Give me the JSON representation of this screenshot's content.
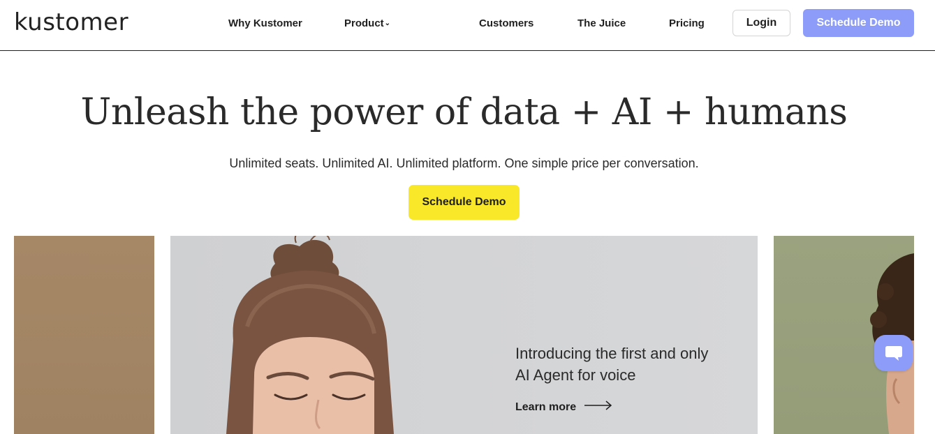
{
  "header": {
    "logo": "kustomer",
    "nav": {
      "why": "Why Kustomer",
      "product": "Product",
      "customers": "Customers",
      "juice": "The Juice",
      "pricing": "Pricing"
    },
    "login_label": "Login",
    "demo_label": "Schedule Demo"
  },
  "hero": {
    "title": "Unleash the power of data + AI + humans",
    "subtitle": "Unlimited seats. Unlimited AI. Unlimited platform. One simple price per conversation.",
    "cta_label": "Schedule Demo"
  },
  "promo": {
    "line1": "Introducing the first and only",
    "line2": "AI Agent for voice",
    "learn_more": "Learn more"
  },
  "icons": {
    "product_dropdown": "chevron-down-icon",
    "learn_more": "arrow-right-icon",
    "chat": "chat-bubble-icon"
  },
  "colors": {
    "accent": "#8c9cf8",
    "cta_yellow": "#f9e82a",
    "text": "#1f1f1f"
  }
}
